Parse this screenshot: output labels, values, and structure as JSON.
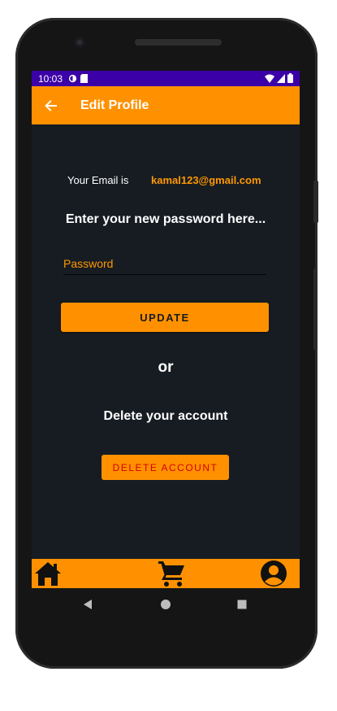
{
  "status_bar": {
    "time": "10:03"
  },
  "app_bar": {
    "title": "Edit Profile"
  },
  "profile": {
    "email_label": "Your Email is",
    "email_value": "kamal123@gmail.com",
    "heading": "Enter your new password here...",
    "password_placeholder": "Password",
    "password_value": "",
    "update_label": "UPDATE",
    "or_text": "or",
    "delete_heading": "Delete your account",
    "delete_label": "DELETE ACCOUNT"
  },
  "bottom_nav": {
    "items": [
      {
        "icon": "home-icon"
      },
      {
        "icon": "cart-icon"
      },
      {
        "icon": "account-icon"
      }
    ]
  },
  "colors": {
    "accent": "#ff9100",
    "status_bar": "#3c00a8",
    "background": "#171c22",
    "delete_text": "#d50000"
  }
}
